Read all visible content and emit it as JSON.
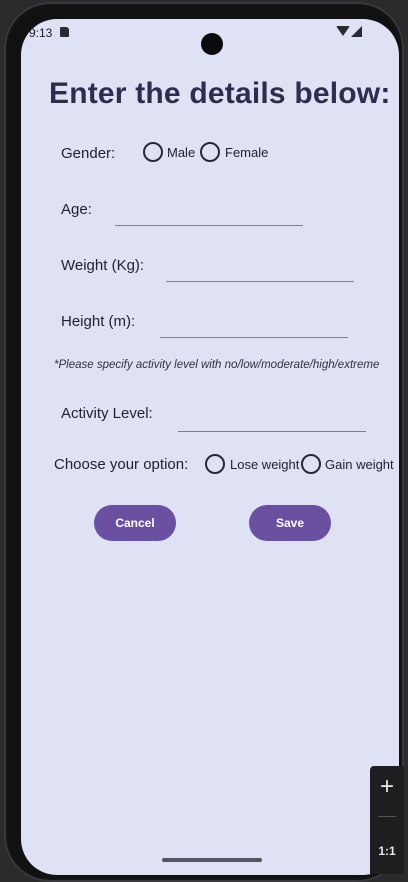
{
  "status_bar": {
    "time": "9:13"
  },
  "form": {
    "title": "Enter the details below:",
    "gender": {
      "label": "Gender:",
      "options": [
        "Male",
        "Female"
      ]
    },
    "age": {
      "label": "Age:",
      "value": ""
    },
    "weight": {
      "label": "Weight (Kg):",
      "value": ""
    },
    "height": {
      "label": "Height (m):",
      "value": ""
    },
    "hint": "*Please specify activity level with no/low/moderate/high/extreme",
    "activity": {
      "label": "Activity Level:",
      "value": ""
    },
    "option": {
      "label": "Choose your option:",
      "choices": [
        "Lose weight",
        "Gain weight"
      ]
    },
    "buttons": {
      "cancel": "Cancel",
      "save": "Save"
    }
  },
  "zoom_panel": {
    "zoom_in": "+",
    "reset": "1:1"
  },
  "colors": {
    "background": "#dfe1f4",
    "accent": "#6a50a0",
    "title": "#2c2e4d"
  }
}
